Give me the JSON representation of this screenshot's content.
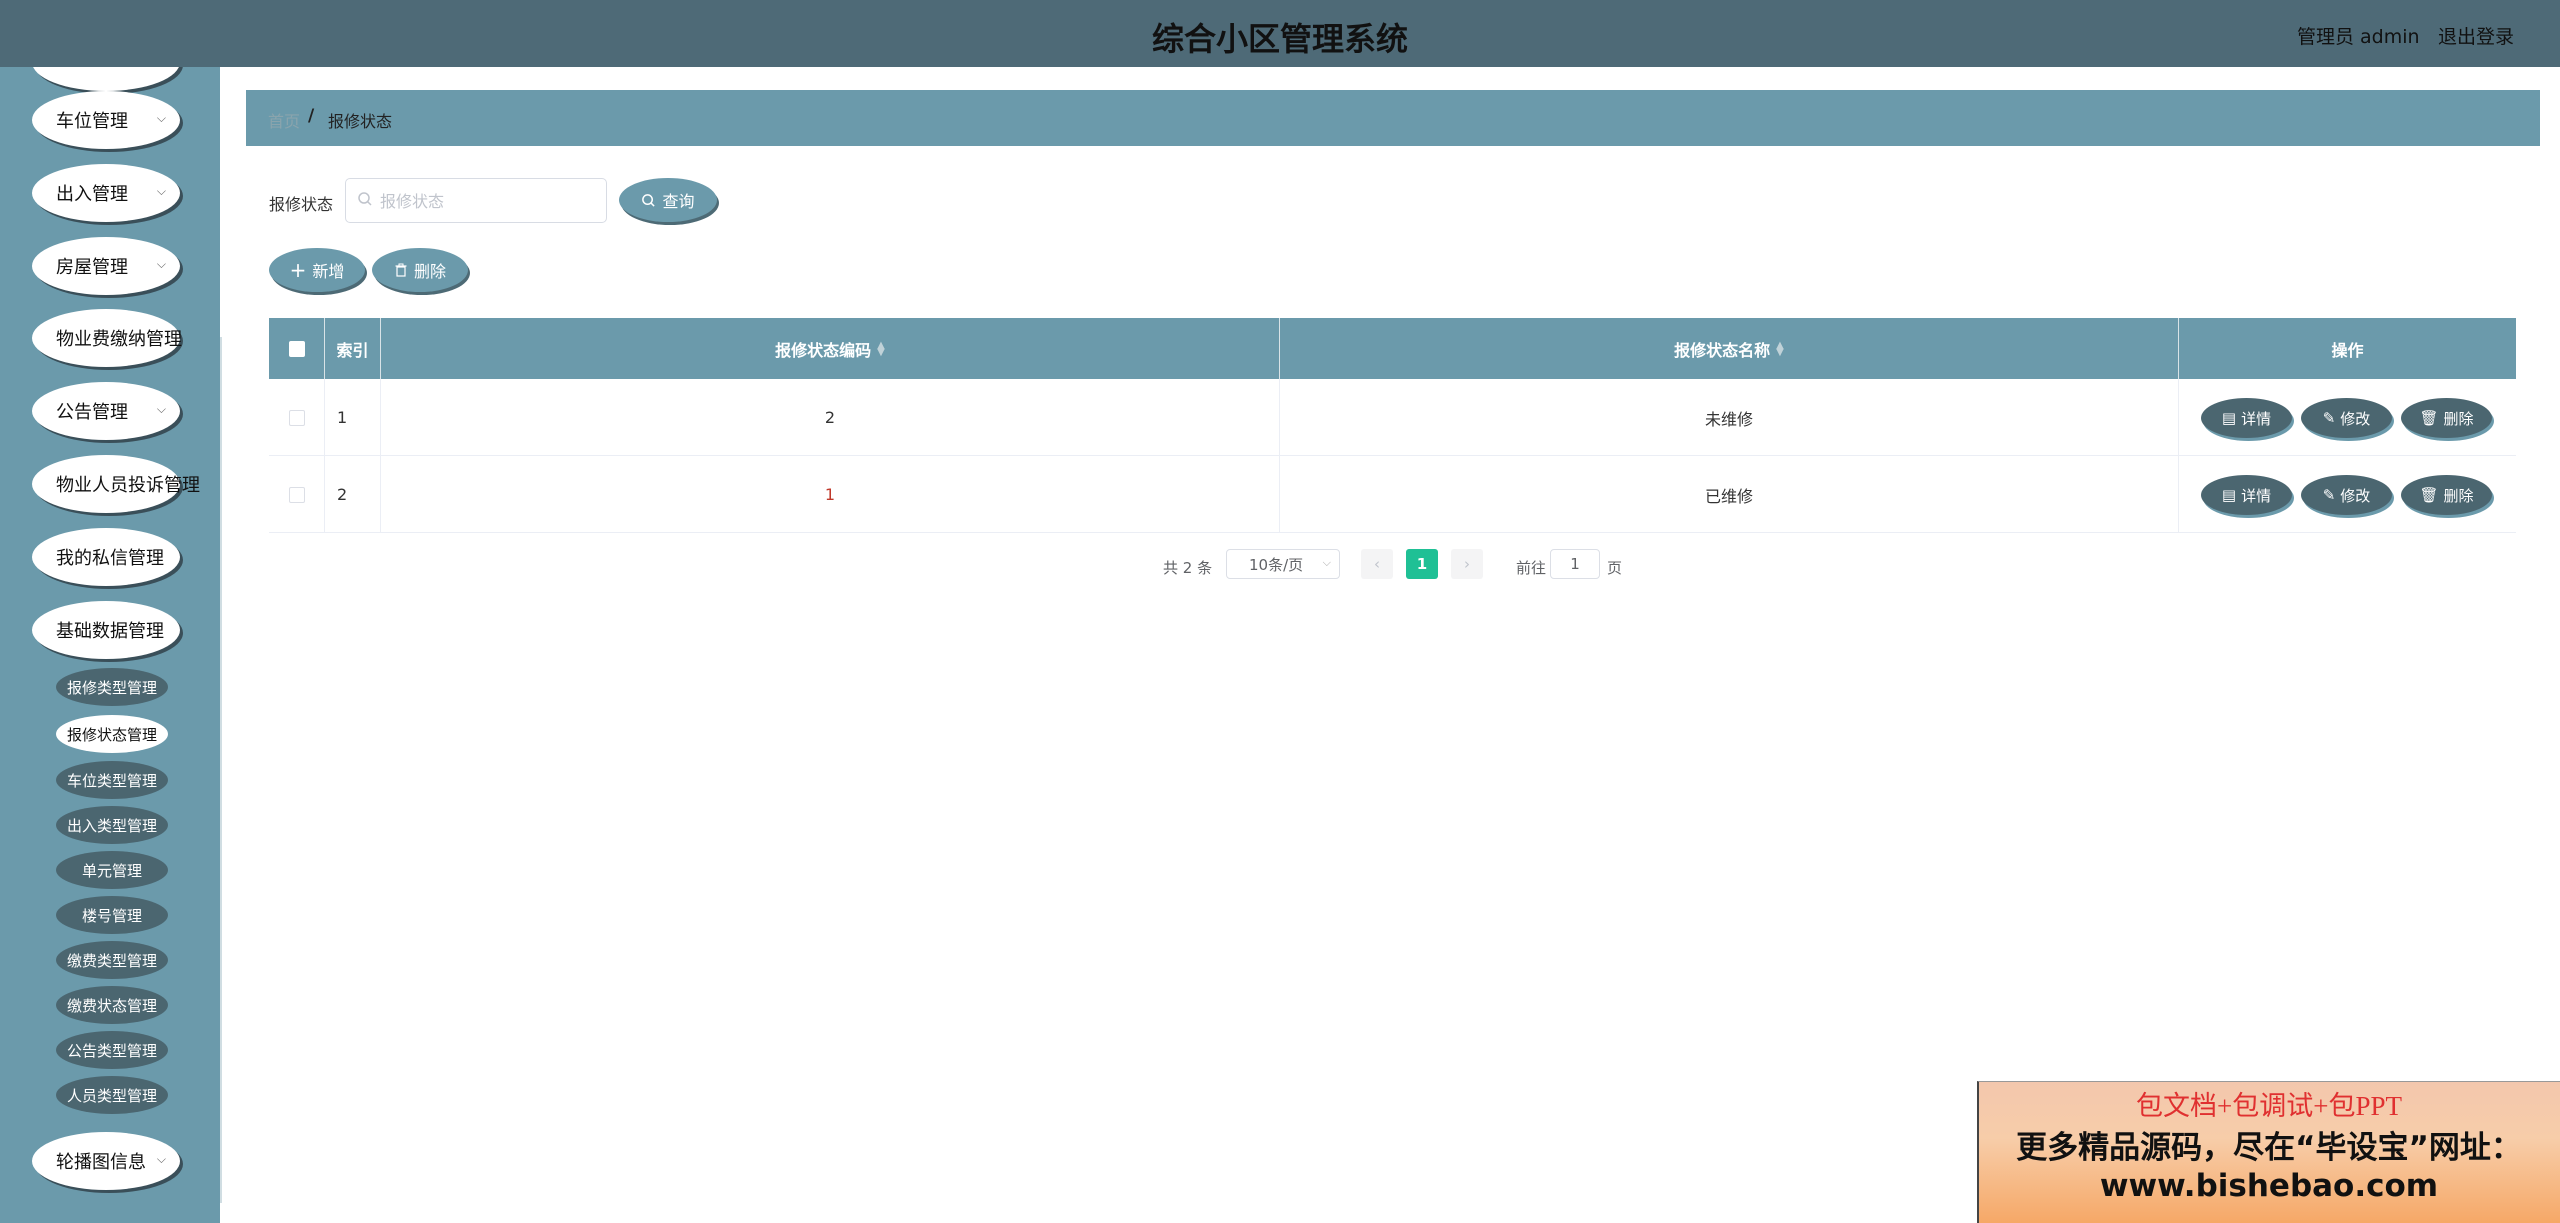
{
  "header": {
    "title": "综合小区管理系统",
    "user": "管理员 admin",
    "logout": "退出登录"
  },
  "sidebar": {
    "menus": [
      {
        "label": "车位管理"
      },
      {
        "label": "出入管理"
      },
      {
        "label": "房屋管理"
      },
      {
        "label": "物业费缴纳管理"
      },
      {
        "label": "公告管理"
      },
      {
        "label": "物业人员投诉管理"
      },
      {
        "label": "我的私信管理"
      },
      {
        "label": "基础数据管理"
      },
      {
        "label": "轮播图信息"
      }
    ],
    "submenu": [
      "报修类型管理",
      "报修状态管理",
      "车位类型管理",
      "出入类型管理",
      "单元管理",
      "楼号管理",
      "缴费类型管理",
      "缴费状态管理",
      "公告类型管理",
      "人员类型管理"
    ],
    "active_submenu": "报修状态管理"
  },
  "breadcrumb": {
    "home": "首页",
    "separator": "/",
    "current": "报修状态"
  },
  "search": {
    "label": "报修状态",
    "placeholder": "报修状态",
    "value": "",
    "button": "查询"
  },
  "toolbar": {
    "add": "新增",
    "delete": "删除"
  },
  "table": {
    "headers": {
      "index": "索引",
      "code": "报修状态编码",
      "name": "报修状态名称",
      "ops": "操作"
    },
    "rows": [
      {
        "index": "1",
        "code": "2",
        "name": "未维修"
      },
      {
        "index": "2",
        "code": "1",
        "name": "已维修"
      }
    ],
    "actions": {
      "detail": "详情",
      "edit": "修改",
      "delete": "删除"
    }
  },
  "pagination": {
    "total": "共 2 条",
    "page_size": "10条/页",
    "current": "1",
    "goto_prefix": "前往",
    "goto_value": "1",
    "goto_suffix": "页"
  },
  "ad": {
    "line1": "包文档+包调试+包PPT",
    "line2": "更多精品源码，尽在“毕设宝”网址：",
    "line3": "www.bishebao.com"
  },
  "colors": {
    "header": "#4e6a77",
    "sidebar": "#6b9aab",
    "accent": "#6b9aab",
    "dark_button": "#4b6670",
    "page_active": "#1fc095"
  }
}
